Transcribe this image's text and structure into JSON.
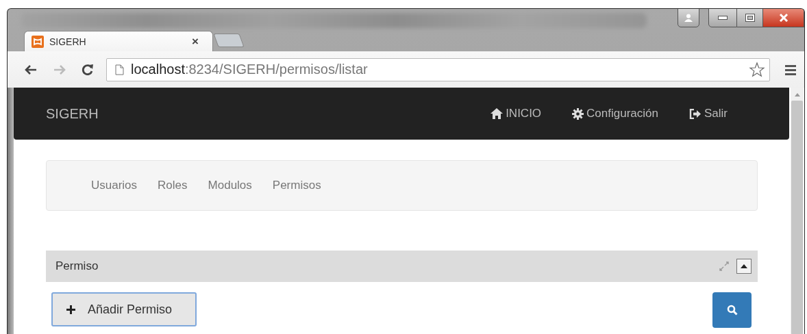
{
  "browser": {
    "tabs": [
      {
        "title": "SIGERH",
        "close": "×",
        "selected": true
      }
    ],
    "address": {
      "host": "localhost",
      "path": ":8234/SIGERH/permisos/listar"
    }
  },
  "navbar": {
    "brand": "SIGERH",
    "items": [
      {
        "label": "INICIO",
        "kind": "home"
      },
      {
        "label": "Configuración",
        "kind": "settings"
      },
      {
        "label": "Salir",
        "kind": "exit"
      }
    ]
  },
  "subnav": [
    "Usuarios",
    "Roles",
    "Modulos",
    "Permisos"
  ],
  "panel": {
    "title": "Permiso",
    "add_button": {
      "label": "Añadir Permiso",
      "focused": true
    }
  }
}
